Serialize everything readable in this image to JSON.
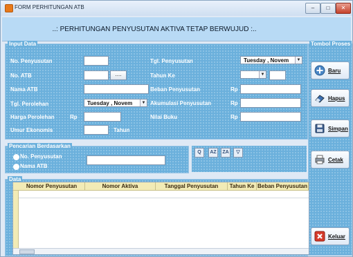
{
  "window": {
    "title": "FORM PERHITUNGAN ATB",
    "controls": {
      "min": "–",
      "max": "□",
      "close": "✕"
    }
  },
  "banner": {
    "text": "..: PERHITUNGAN PENYUSUTAN AKTIVA TETAP BERWUJUD :.."
  },
  "input_data": {
    "group_title": "Input Data",
    "no_penyusutan": {
      "label": "No. Penyusutan",
      "value": ""
    },
    "no_atb": {
      "label": "No. ATB",
      "value": "",
      "browse": "...."
    },
    "nama_atb": {
      "label": "Nama ATB",
      "value": ""
    },
    "tgl_perolehan": {
      "label": "Tgl. Perolehan",
      "value": "Tuesday , Novem"
    },
    "harga_perolehan": {
      "label": "Harga Perolehan",
      "prefix": "Rp",
      "value": ""
    },
    "umur_ekonomis": {
      "label": "Umur Ekonomis",
      "value": "",
      "suffix": "Tahun"
    },
    "tgl_penyusutan": {
      "label": "Tgl. Penyusutan",
      "value": "Tuesday , Novem"
    },
    "tahun_ke": {
      "label": "Tahun Ke",
      "value": ""
    },
    "beban_penyusutan": {
      "label": "Beban Penyusutan",
      "prefix": "Rp",
      "value": ""
    },
    "akumulasi_penyusutan": {
      "label": "Akumulasi Penyusutan",
      "prefix": "Rp",
      "value": ""
    },
    "nilai_buku": {
      "label": "Nilai Buku",
      "prefix": "Rp",
      "value": ""
    }
  },
  "pencarian": {
    "group_title": "Pencarian Berdasarkan",
    "options": [
      "No. Penyusutan",
      "Nama ATB"
    ],
    "search_value": ""
  },
  "tombol_proses": {
    "group_title": "Tombol Proses",
    "baru": "Baru",
    "hapus": "Hapus",
    "simpan": "Simpan",
    "cetak": "Cetak",
    "keluar": "Keluar"
  },
  "data": {
    "group_title": "Data",
    "columns": [
      "Nomor Penyusutan",
      "Nomor Aktiva",
      "Tanggal Penyusutan",
      "Tahun Ke",
      "Beban Penyusutan"
    ]
  },
  "colors": {
    "panel": "#6bb0dc",
    "banner": "#b8daf5",
    "grid_header": "#f2ebb6"
  }
}
